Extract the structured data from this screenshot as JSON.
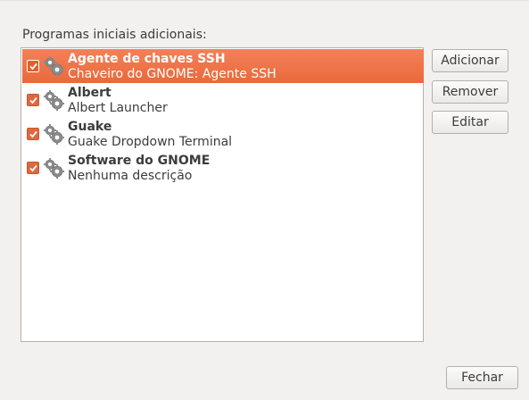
{
  "section_label": "Programas iniciais adicionais:",
  "programs": [
    {
      "name": "Agente de chaves SSH",
      "description": "Chaveiro do GNOME: Agente SSH",
      "enabled": true,
      "selected": true,
      "icon": "gears-icon"
    },
    {
      "name": "Albert",
      "description": "Albert Launcher",
      "enabled": true,
      "selected": false,
      "icon": "gears-icon"
    },
    {
      "name": "Guake",
      "description": "Guake Dropdown Terminal",
      "enabled": true,
      "selected": false,
      "icon": "gears-icon"
    },
    {
      "name": "Software do GNOME",
      "description": "Nenhuma descrição",
      "enabled": true,
      "selected": false,
      "icon": "gears-icon"
    }
  ],
  "buttons": {
    "add": "Adicionar",
    "remove": "Remover",
    "edit": "Editar",
    "close": "Fechar"
  },
  "colors": {
    "accent": "#e96a3a",
    "checkbox": "#e0683c"
  }
}
